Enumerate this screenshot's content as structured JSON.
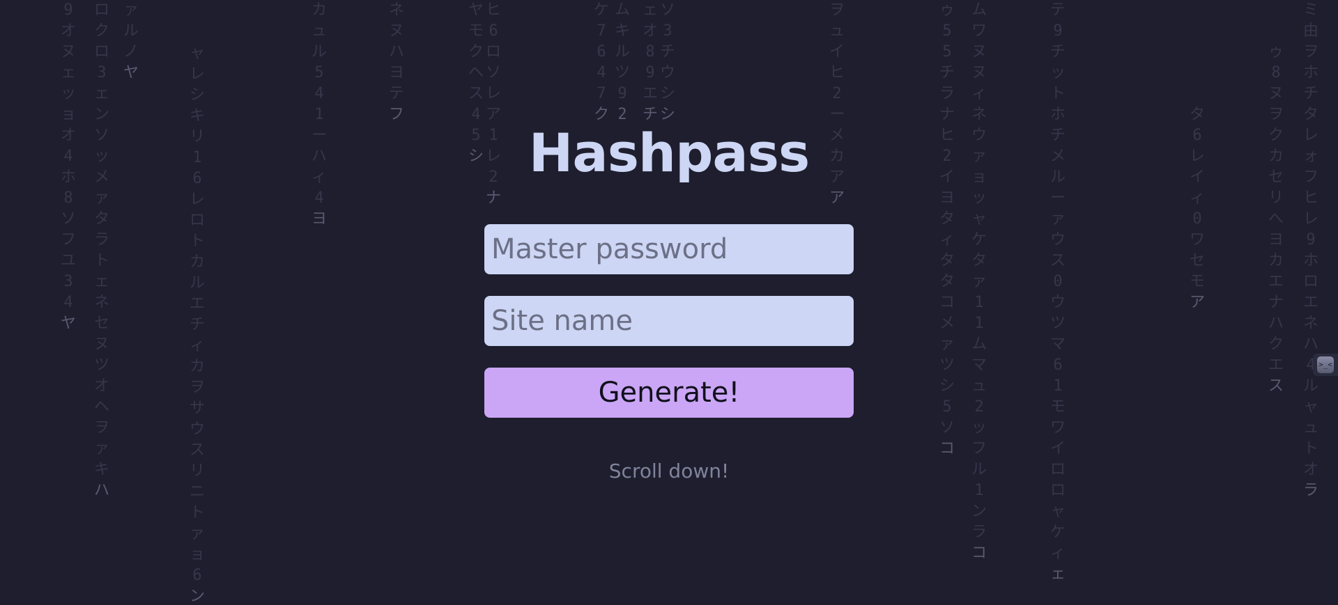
{
  "app": {
    "title": "Hashpass"
  },
  "form": {
    "master_placeholder": "Master password",
    "site_placeholder": "Site name",
    "generate_label": "Generate!"
  },
  "hint": {
    "scroll": "Scroll down!"
  },
  "extension_tab": {
    "icon": "terminal-face-icon",
    "glyph": ">_<"
  },
  "colors": {
    "background": "#1e1e2e",
    "title": "#cdd6f4",
    "field_bg": "#cdd6f4",
    "button_bg": "#cba6f7",
    "hint": "#7f849c"
  },
  "rain": [
    "9オヌェッョオ4ホ8ソフユ34ヤ",
    "ロクロ3ェンソッメァタラトェネセヌツオヘヲァキハ",
    "ァルノヤ",
    "ャレシキリ16レロトカルエチィカヲサウスリニトァョ6ン",
    "カュル541ーハィ4ヨ",
    "ネヌハヨテフ",
    "ヤモクヘス45シ",
    "ヒ6ロソレア1レ2ナ",
    "ケ7647ク",
    "ムキルツ92",
    "ェオ89エチ",
    "ソ3チウシシ",
    "ヲュイヒ2ーメカアア",
    "ゥ55チラナヒ2イヨタィタタコメァツシ5ソコ",
    "ムワヌヌィネウァョッャケタァ11ムマュ2ッフル1ンラコ",
    "テ9チットホチメルーァウス0ウツマ61モワイロロャケィェ",
    "タ6レイィ0ワセモア",
    "ゥ8ヌヲクカセリへヨカエナハクエス",
    "ミ由ヲホチタレォフヒレ9ホロエネハ4ルャュトオラ"
  ]
}
